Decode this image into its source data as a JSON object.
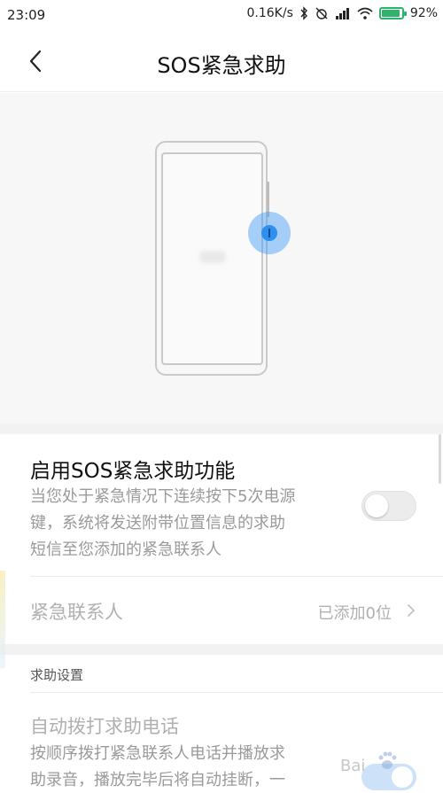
{
  "status_bar": {
    "time": "23:09",
    "net_speed": "0.16K/s",
    "battery_pct": "92%",
    "icons": [
      "bluetooth-icon",
      "mute-alarm-icon",
      "signal-icon",
      "wifi-icon",
      "battery-icon"
    ],
    "battery_color": "#2db36a"
  },
  "header": {
    "title": "SOS紧急求助",
    "back_icon": "chevron-left-icon"
  },
  "illustration": {
    "accent": "#2d8ff0"
  },
  "enable_sos": {
    "title": "启用SOS紧急求助功能",
    "desc_line1": "当您处于紧急情况下连续按下5次电源",
    "desc_line2": "键，系统将发送附带位置信息的求助",
    "desc_line3": "短信至您添加的紧急联系人",
    "toggle_on": false
  },
  "contacts": {
    "label": "紧急联系人",
    "value": "已添加0位"
  },
  "help_settings": {
    "section_title": "求助设置",
    "auto_call_title": "自动拨打求助电话",
    "auto_call_desc_line1": "按顺序拨打紧急联系人电话并播放求",
    "auto_call_desc_line2": "助录音，播放完毕后将自动挂断，一",
    "auto_call_toggle_on": true
  },
  "watermark": {
    "text": "Bai"
  }
}
